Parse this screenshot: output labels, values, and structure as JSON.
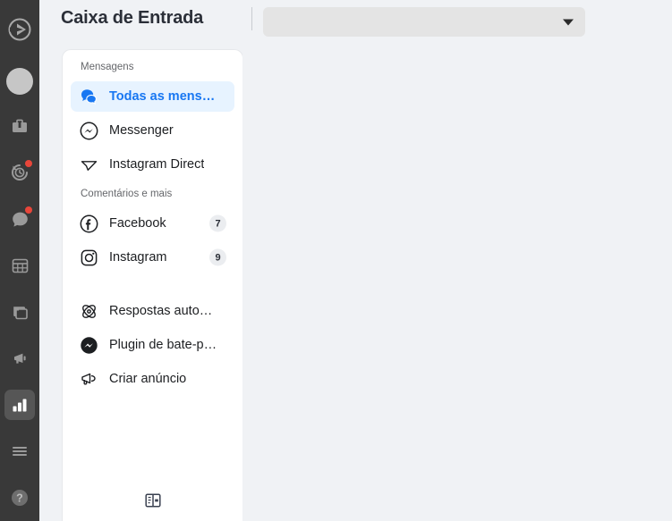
{
  "header": {
    "title": "Caixa de Entrada",
    "dropdown": {
      "value": "",
      "placeholder": "",
      "icon": "chevron-down-icon"
    }
  },
  "rail": {
    "logo_icon": "app-logo-icon",
    "avatar_icon": "user-avatar",
    "items": [
      {
        "icon": "briefcase-icon",
        "badge": false,
        "active": false
      },
      {
        "icon": "history-clock-icon",
        "badge": true,
        "active": false
      },
      {
        "icon": "chat-bubble-icon",
        "badge": true,
        "active": false
      },
      {
        "icon": "calendar-grid-icon",
        "badge": false,
        "active": false
      },
      {
        "icon": "windows-copy-icon",
        "badge": false,
        "active": false
      },
      {
        "icon": "megaphone-icon",
        "badge": false,
        "active": false
      },
      {
        "icon": "bar-chart-icon",
        "badge": false,
        "active": true
      },
      {
        "icon": "hamburger-menu-icon",
        "badge": false,
        "active": false
      },
      {
        "icon": "help-question-icon",
        "badge": false,
        "active": false
      }
    ]
  },
  "panel": {
    "sections": [
      {
        "label": "Mensagens",
        "items": [
          {
            "label": "Todas as mens…",
            "icon": "chat-bubbles-icon",
            "selected": true,
            "badge": ""
          },
          {
            "label": "Messenger",
            "icon": "messenger-icon",
            "selected": false,
            "badge": ""
          },
          {
            "label": "Instagram Direct",
            "icon": "paper-plane-icon",
            "selected": false,
            "badge": ""
          }
        ]
      },
      {
        "label": "Comentários e mais",
        "items": [
          {
            "label": "Facebook",
            "icon": "facebook-icon",
            "selected": false,
            "badge": "7"
          },
          {
            "label": "Instagram",
            "icon": "instagram-icon",
            "selected": false,
            "badge": "9"
          }
        ]
      },
      {
        "label": "",
        "items": [
          {
            "label": "Respostas auto…",
            "icon": "atom-icon",
            "selected": false,
            "badge": ""
          },
          {
            "label": "Plugin de bate-p…",
            "icon": "messenger-filled-icon",
            "selected": false,
            "badge": ""
          },
          {
            "label": "Criar anúncio",
            "icon": "bullhorn-icon",
            "selected": false,
            "badge": ""
          }
        ]
      }
    ],
    "collapse_icon": "panel-collapse-icon"
  },
  "colors": {
    "rail_bg": "#393939",
    "page_bg": "#F0F2F5",
    "panel_bg": "#FFFFFF",
    "accent_blue": "#1877F2",
    "selected_bg": "#E7F3FF",
    "badge_bg": "#EBEDF0",
    "notification_red": "#E8463A",
    "dropdown_bg": "#E4E4E4"
  }
}
